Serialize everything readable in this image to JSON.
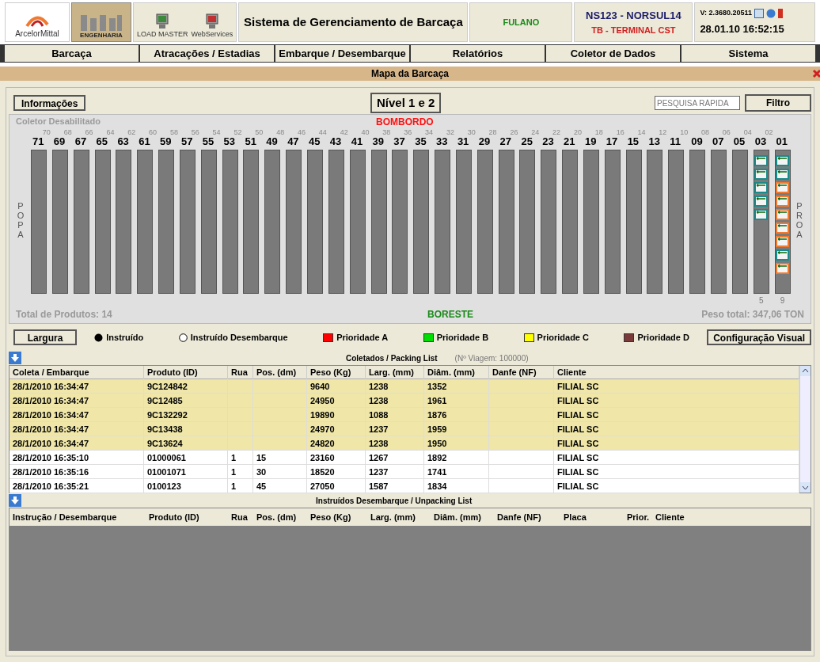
{
  "header": {
    "logo_text": "ArcelorMittal",
    "logo2_text": "ENGENHARIA",
    "tools": [
      {
        "label": "LOAD MASTER",
        "color": "#3a8a3a"
      },
      {
        "label": "WebServices",
        "color": "#c03030"
      }
    ],
    "title": "Sistema de Gerenciamento de Barcaça",
    "user": "FULANO",
    "vessel": "NS123 - NORSUL14",
    "terminal": "TB - TERMINAL CST",
    "version": "V: 2.3680.20511",
    "datetime": "28.01.10 16:52:15"
  },
  "menu": [
    {
      "label": "Barcaça"
    },
    {
      "label": "Atracações / Estadias"
    },
    {
      "label": "Embarque / Desembarque"
    },
    {
      "label": "Relatórios"
    },
    {
      "label": "Coletor de Dados"
    },
    {
      "label": "Sistema"
    }
  ],
  "panel_title": "Mapa da Barcaça",
  "toolbar": {
    "info_button": "Informações",
    "level": "Nível 1 e 2",
    "search": {
      "placeholder": "PESQUISA RÁPIDA"
    },
    "filter_button": "Filtro"
  },
  "map": {
    "collector_status": "Coletor Desabilitado",
    "top_side": "BOMBORDO",
    "bottom_side": "BORESTE",
    "left_end": "POPA",
    "right_end": "PROA",
    "total_products": "Total de Produtos: 14",
    "total_weight": "Peso total: 347,06 TON",
    "bays": [
      {
        "number": "71"
      },
      {
        "number": "69",
        "between": "70"
      },
      {
        "number": "67",
        "between": "68"
      },
      {
        "number": "65",
        "between": "66"
      },
      {
        "number": "63",
        "between": "64"
      },
      {
        "number": "61",
        "between": "62"
      },
      {
        "number": "59",
        "between": "60"
      },
      {
        "number": "57",
        "between": "58"
      },
      {
        "number": "55",
        "between": "56"
      },
      {
        "number": "53",
        "between": "54"
      },
      {
        "number": "51",
        "between": "52"
      },
      {
        "number": "49",
        "between": "50"
      },
      {
        "number": "47",
        "between": "48"
      },
      {
        "number": "45",
        "between": "46"
      },
      {
        "number": "43",
        "between": "44"
      },
      {
        "number": "41",
        "between": "42"
      },
      {
        "number": "39",
        "between": "40"
      },
      {
        "number": "37",
        "between": "38"
      },
      {
        "number": "35",
        "between": "36"
      },
      {
        "number": "33",
        "between": "34"
      },
      {
        "number": "31",
        "between": "32"
      },
      {
        "number": "29",
        "between": "30"
      },
      {
        "number": "27",
        "between": "28"
      },
      {
        "number": "25",
        "between": "26"
      },
      {
        "number": "23",
        "between": "24"
      },
      {
        "number": "21",
        "between": "22"
      },
      {
        "number": "19",
        "between": "20"
      },
      {
        "number": "17",
        "between": "18"
      },
      {
        "number": "15",
        "between": "16"
      },
      {
        "number": "13",
        "between": "14"
      },
      {
        "number": "11",
        "between": "12"
      },
      {
        "number": "09",
        "between": "10"
      },
      {
        "number": "07",
        "between": "08"
      },
      {
        "number": "05",
        "between": "06"
      },
      {
        "number": "03",
        "between": "04",
        "count": "5",
        "products": [
          {
            "color": "#1a8a8a"
          },
          {
            "color": "#1a8a8a"
          },
          {
            "color": "#1a8a8a"
          },
          {
            "color": "#1a8a8a"
          },
          {
            "color": "#1a8a8a"
          }
        ]
      },
      {
        "number": "01",
        "between": "02",
        "count": "9",
        "products": [
          {
            "color": "#1a8a8a"
          },
          {
            "color": "#1a8a8a"
          },
          {
            "color": "#f07a30"
          },
          {
            "color": "#f07a30"
          },
          {
            "color": "#f07a30"
          },
          {
            "color": "#f07a30"
          },
          {
            "color": "#f07a30"
          },
          {
            "color": "#1a8a8a"
          },
          {
            "color": "#f07a30"
          }
        ]
      }
    ]
  },
  "legend": {
    "width_button": "Largura",
    "items": [
      {
        "kind": "dot",
        "label": "Instruído"
      },
      {
        "kind": "ring",
        "label": "Instruído Desembarque"
      },
      {
        "kind": "square",
        "label": "Prioridade A",
        "color": "#ff0000"
      },
      {
        "kind": "square",
        "label": "Prioridade B",
        "color": "#00dd00"
      },
      {
        "kind": "square",
        "label": "Prioridade C",
        "color": "#ffff00"
      },
      {
        "kind": "square",
        "label": "Prioridade D",
        "color": "#7a3a3a"
      }
    ],
    "config_button": "Configuração Visual"
  },
  "packing_list": {
    "title": "Coletados / Packing List",
    "trip": "(Nº Viagem: 100000)",
    "columns": [
      "Coleta / Embarque",
      "Produto (ID)",
      "Rua",
      "Pos. (dm)",
      "Peso (Kg)",
      "Larg. (mm)",
      "Diâm. (mm)",
      "Danfe (NF)",
      "Cliente"
    ],
    "rows": [
      {
        "highlighted": true,
        "cells": [
          "28/1/2010 16:34:47",
          "9C124842",
          "",
          "",
          "9640",
          "1238",
          "1352",
          "",
          "FILIAL SC"
        ]
      },
      {
        "highlighted": true,
        "cells": [
          "28/1/2010 16:34:47",
          "9C12485",
          "",
          "",
          "24950",
          "1238",
          "1961",
          "",
          "FILIAL SC"
        ]
      },
      {
        "highlighted": true,
        "cells": [
          "28/1/2010 16:34:47",
          "9C132292",
          "",
          "",
          "19890",
          "1088",
          "1876",
          "",
          "FILIAL SC"
        ]
      },
      {
        "highlighted": true,
        "cells": [
          "28/1/2010 16:34:47",
          "9C13438",
          "",
          "",
          "24970",
          "1237",
          "1959",
          "",
          "FILIAL SC"
        ]
      },
      {
        "highlighted": true,
        "cells": [
          "28/1/2010 16:34:47",
          "9C13624",
          "",
          "",
          "24820",
          "1238",
          "1950",
          "",
          "FILIAL SC"
        ]
      },
      {
        "highlighted": false,
        "cells": [
          "28/1/2010 16:35:10",
          "01000061",
          "1",
          "15",
          "23160",
          "1267",
          "1892",
          "",
          "FILIAL SC"
        ]
      },
      {
        "highlighted": false,
        "cells": [
          "28/1/2010 16:35:16",
          "01001071",
          "1",
          "30",
          "18520",
          "1237",
          "1741",
          "",
          "FILIAL SC"
        ]
      },
      {
        "highlighted": false,
        "cells": [
          "28/1/2010 16:35:21",
          "0100123",
          "1",
          "45",
          "27050",
          "1587",
          "1834",
          "",
          "FILIAL SC"
        ]
      }
    ]
  },
  "unpacking_list": {
    "title": "Instruídos Desembarque / Unpacking List",
    "columns": [
      "Instrução / Desembarque",
      "Produto (ID)",
      "Rua",
      "Pos. (dm)",
      "Peso (Kg)",
      "Larg. (mm)",
      "Diâm. (mm)",
      "Danfe (NF)",
      "Placa",
      "Prior.",
      "Cliente"
    ]
  }
}
